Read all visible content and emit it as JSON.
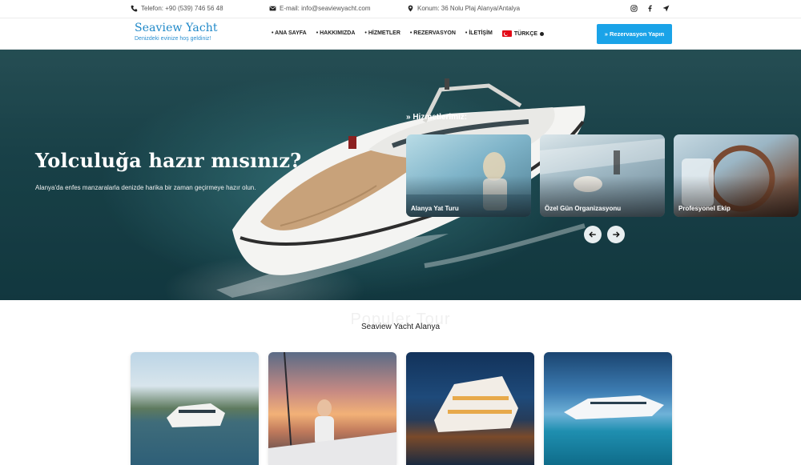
{
  "topbar": {
    "phone": "Telefon: +90 (539) 746 56 48",
    "email": "E-mail: info@seaviewyacht.com",
    "location": "Konum: 36 Nolu Plaj Alanya/Antalya",
    "social": [
      "instagram-icon",
      "facebook-icon",
      "location-arrow-icon"
    ]
  },
  "header": {
    "brand_title": "Seaview Yacht",
    "brand_subtitle": "Denizdeki evinize hoş geldiniz!",
    "nav": [
      "• ANA SAYFA",
      "• HAKKIMIZDA",
      "• HİZMETLER",
      "• REZERVASYON",
      "• İLETİŞİM"
    ],
    "language": "TÜRKÇE",
    "cta": "» Rezervasyon Yapın"
  },
  "hero": {
    "title": "Yolculuğa hazır mısınız?",
    "subtitle": "Alanya'da enfes manzaralarla denizde harika bir zaman geçirmeye hazır olun.",
    "services_heading": "» Hizmetlerimiz:",
    "services": [
      "Alanya Yat Turu",
      "Özel Gün Organizasyonu",
      "Profesyonel Ekip"
    ]
  },
  "popular": {
    "ghost": "Populer Tour",
    "title": "Seaview Yacht Alanya"
  },
  "colors": {
    "accent": "#1aa3e8",
    "brand": "#1e88c8"
  }
}
